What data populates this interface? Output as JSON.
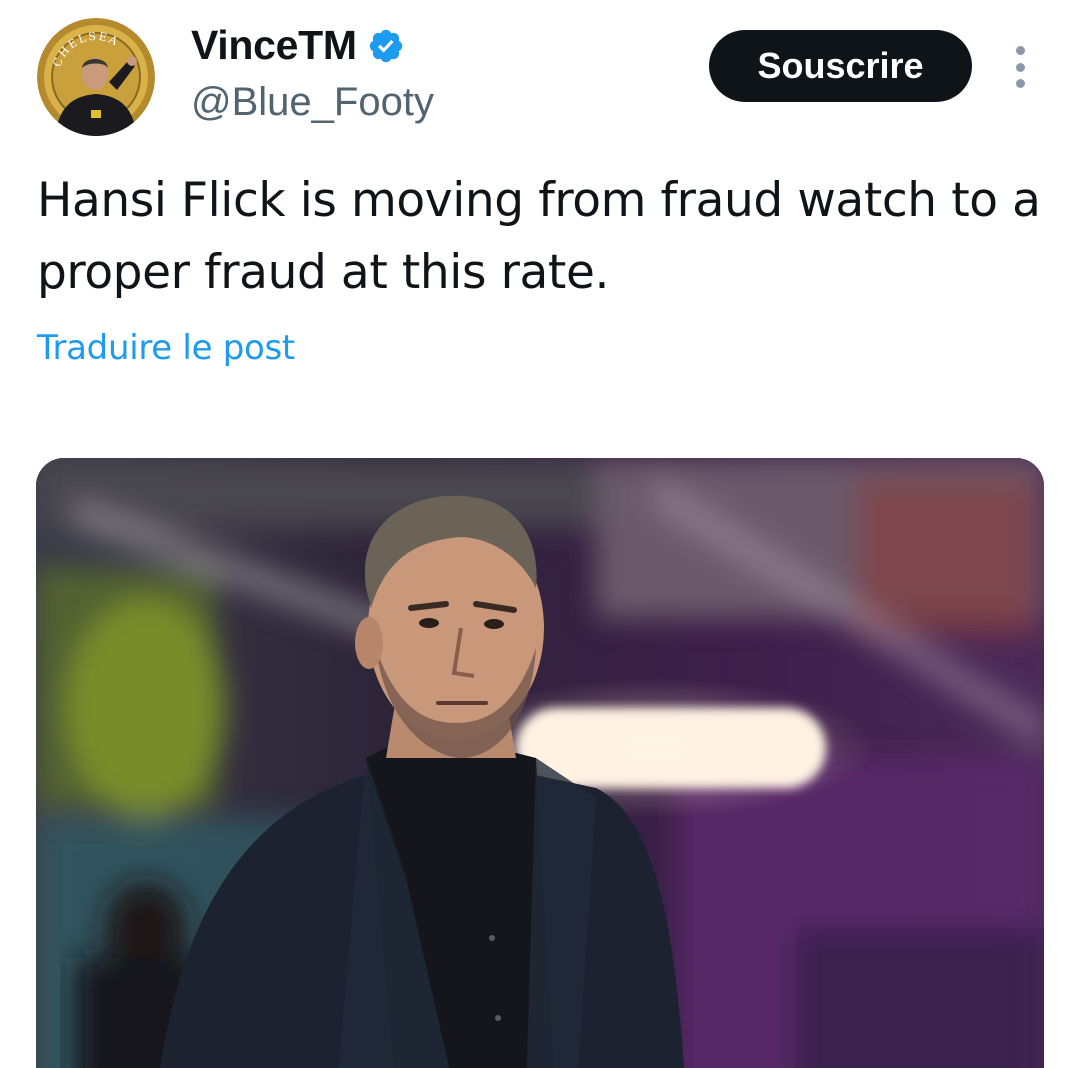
{
  "author": {
    "display_name": "VinceTM",
    "handle": "@Blue_Footy",
    "avatar_icon": "club-crest-avatar",
    "avatar_crest_text": "CHELSEA",
    "verified_icon": "verified-badge-icon",
    "verified_color": "#1d9bf0"
  },
  "actions": {
    "subscribe_label": "Souscrire",
    "more_icon": "more-options-icon"
  },
  "post": {
    "text": "Hansi Flick is moving from fraud watch to a proper fraud at this rate.",
    "translate_label": "Traduire le post"
  },
  "media": {
    "type": "photo",
    "subject_icon": "coach-photo"
  },
  "colors": {
    "text_primary": "#0f1419",
    "text_secondary": "#536471",
    "link": "#1d9bf0",
    "button_bg": "#0f1419",
    "button_text": "#ffffff"
  }
}
